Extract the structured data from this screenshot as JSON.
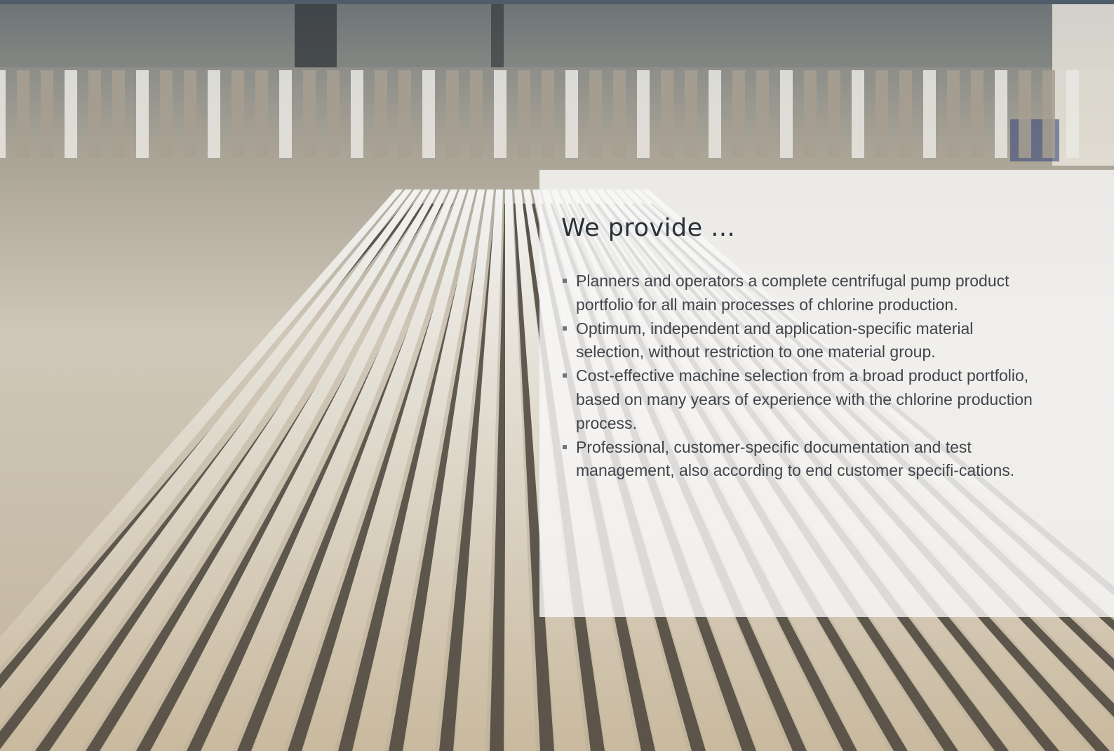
{
  "panel": {
    "title": "We provide ...",
    "items": [
      "Planners and operators a complete centrifugal pump product portfolio for all main processes of chlorine production.",
      "Optimum, independent and application-specific material selection, without restriction to one material group.",
      "Cost-effective machine selection from a broad product portfolio, based on many years of experience with the chlorine production process.",
      "Professional, customer-specific documentation and test management, also according to end customer specifi-cations."
    ]
  },
  "colors": {
    "top_bar": "#4f5c6a",
    "panel_background": "#f8f8f8",
    "title_text": "#2a3138",
    "body_text": "#3f454b"
  },
  "icons": {
    "bullet": "square-bullet-icon"
  }
}
